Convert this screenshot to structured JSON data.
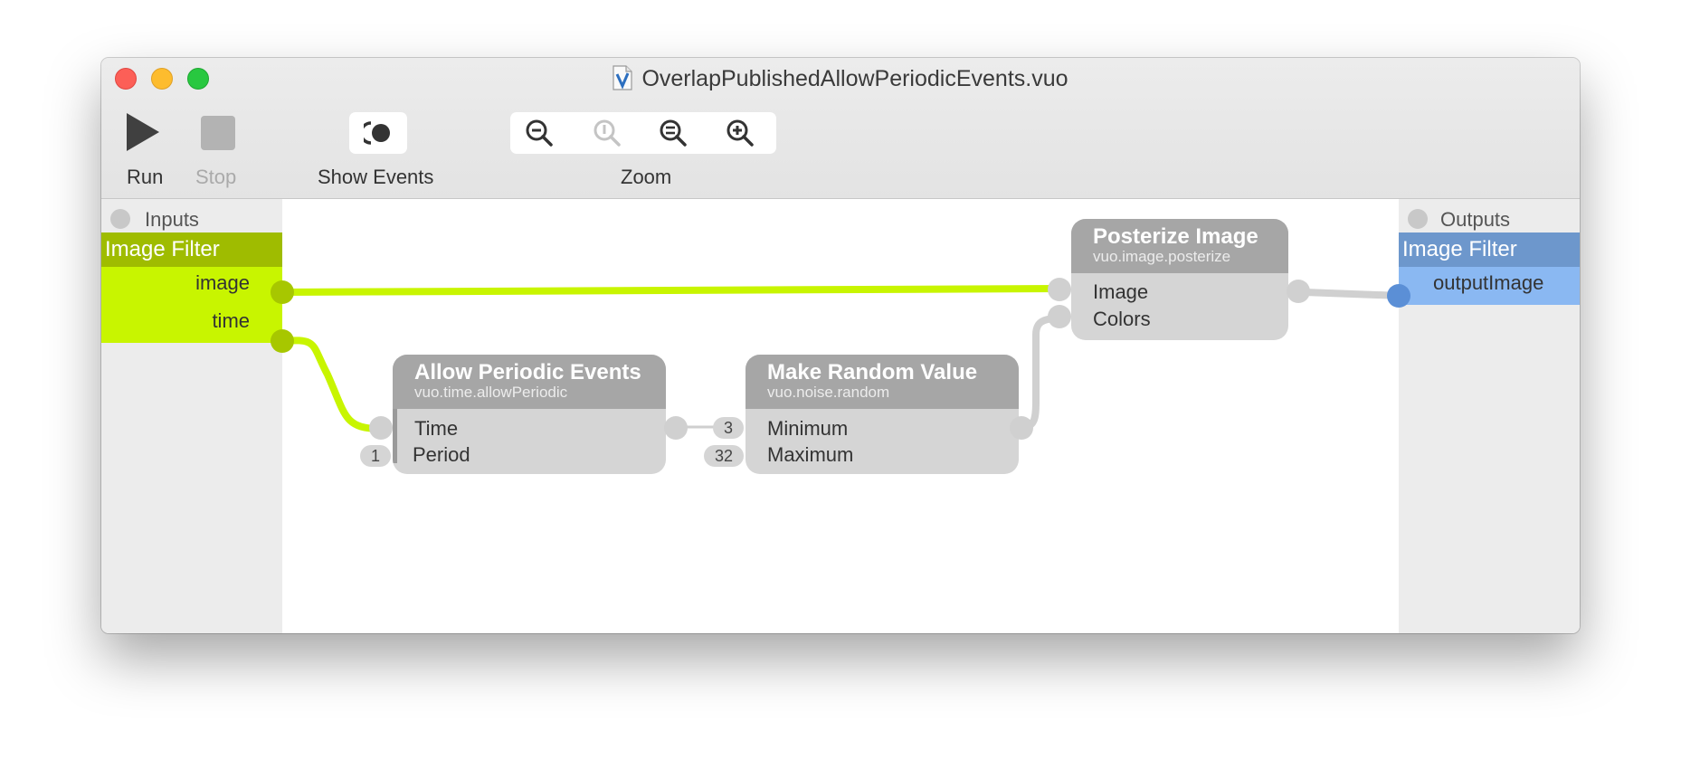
{
  "window": {
    "title": "OverlapPublishedAllowPeriodicEvents.vuo",
    "doc_icon": "vuo-document-icon"
  },
  "toolbar": {
    "run_label": "Run",
    "stop_label": "Stop",
    "show_events_label": "Show Events",
    "zoom_label": "Zoom",
    "zoom_icons": [
      "zoom-out-icon",
      "zoom-actual-size-icon",
      "zoom-to-fit-icon",
      "zoom-in-icon"
    ]
  },
  "inputs_panel": {
    "heading": "Inputs",
    "group_title": "Image Filter",
    "ports": [
      "image",
      "time"
    ],
    "color": "#c8f500"
  },
  "outputs_panel": {
    "heading": "Outputs",
    "group_title": "Image Filter",
    "ports": [
      "outputImage"
    ],
    "color": "#8ab8f2"
  },
  "nodes": {
    "allow_periodic": {
      "title": "Allow Periodic Events",
      "subtitle": "vuo.time.allowPeriodic",
      "ports": [
        "Time",
        "Period"
      ],
      "period_value": "1"
    },
    "make_random": {
      "title": "Make Random Value",
      "subtitle": "vuo.noise.random",
      "ports": [
        "Minimum",
        "Maximum"
      ],
      "minimum_value": "3",
      "maximum_value": "32"
    },
    "posterize": {
      "title": "Posterize Image",
      "subtitle": "vuo.image.posterize",
      "ports": [
        "Image",
        "Colors"
      ]
    }
  }
}
